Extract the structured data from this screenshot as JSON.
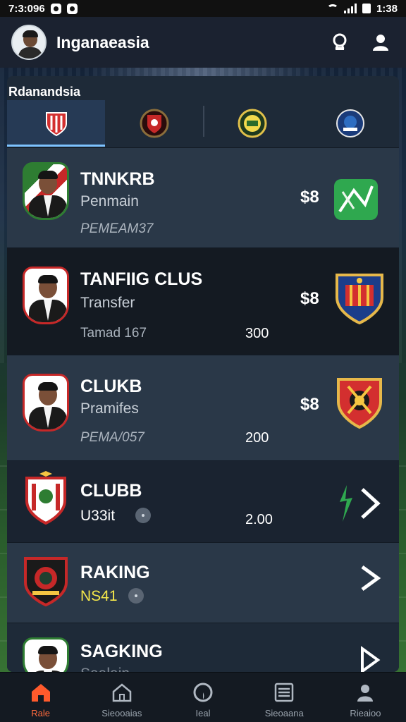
{
  "status_bar": {
    "time": "7:3:096",
    "clock": "1:38"
  },
  "header": {
    "title": "Inganaeasia"
  },
  "panel": {
    "title": "Rdanandsia",
    "tabs": [
      {
        "icon": "red-shield-crest-icon"
      },
      {
        "icon": "dark-red-crest-icon"
      },
      {
        "icon": "green-yellow-crest-icon"
      },
      {
        "icon": "blue-crest-icon"
      }
    ]
  },
  "rows": [
    {
      "name": "TNNKRB",
      "sub": "Penmain",
      "meta": "PEMEAM37",
      "price": "$8",
      "value": "",
      "badge_icon": "player-avatar-icon",
      "right_icon": "green-arrow-crest-icon"
    },
    {
      "name": "TANFIIG CLUS",
      "sub": "Transfer",
      "meta": "Tamad 167",
      "price": "$8",
      "value": "300",
      "badge_icon": "player-avatar-icon",
      "right_icon": "blue-red-crest-icon"
    },
    {
      "name": "CLUKB",
      "sub": "Pramifes",
      "meta": "PEMA/057",
      "price": "$8",
      "value": "200",
      "badge_icon": "player-avatar-icon",
      "right_icon": "red-crest-icon"
    },
    {
      "name": "CLUBB",
      "sub": "U33it",
      "meta": "",
      "price": "",
      "value": "2.00",
      "badge_icon": "club-crest-icon",
      "right_icon": "chevron-right-icon"
    },
    {
      "name": "RAKING",
      "sub": "NS41",
      "meta": "",
      "price": "",
      "value": "",
      "badge_icon": "black-red-crest-icon",
      "right_icon": "chevron-right-icon"
    },
    {
      "name": "SAGKING",
      "sub": "Saalain",
      "meta": "",
      "price": "",
      "value": "",
      "badge_icon": "player-avatar-icon",
      "right_icon": "chevron-right-icon"
    }
  ],
  "bottom_nav": [
    {
      "label": "Rale",
      "icon": "home-icon",
      "active": true
    },
    {
      "label": "Sieooaias",
      "icon": "home-outline-icon",
      "active": false
    },
    {
      "label": "Ieal",
      "icon": "clock-icon",
      "active": false
    },
    {
      "label": "Sieoaana",
      "icon": "list-icon",
      "active": false
    },
    {
      "label": "Rieaioo",
      "icon": "profile-icon",
      "active": false
    }
  ],
  "colors": {
    "accent": "#7ec3ff",
    "active_nav": "#ff6a3d",
    "highlight_text": "#f5e84a"
  }
}
